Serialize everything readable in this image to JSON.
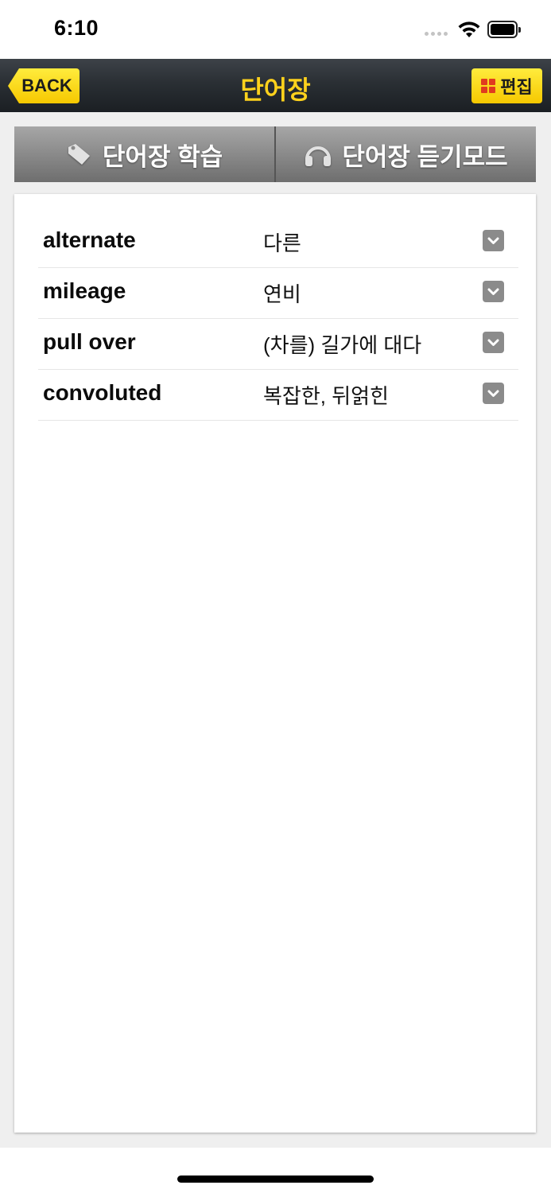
{
  "status_bar": {
    "time": "6:10"
  },
  "nav": {
    "back_label": "BACK",
    "title": "단어장",
    "edit_label": "편집"
  },
  "tabs": [
    {
      "label": "단어장 학습",
      "icon": "tag-icon"
    },
    {
      "label": "단어장 듣기모드",
      "icon": "headphones-icon"
    }
  ],
  "words": [
    {
      "word": "alternate",
      "meaning": "다른"
    },
    {
      "word": "mileage",
      "meaning": "연비"
    },
    {
      "word": "pull over",
      "meaning": "(차를) 길가에 대다"
    },
    {
      "word": "convoluted",
      "meaning": "복잡한, 뒤얽힌"
    }
  ],
  "colors": {
    "accent_yellow": "#ffd21c",
    "button_yellow": "#f6c800",
    "nav_dark": "#2a2f34",
    "tab_gray": "#8a8a8a",
    "grid_icon_red": "#e03b1f"
  }
}
